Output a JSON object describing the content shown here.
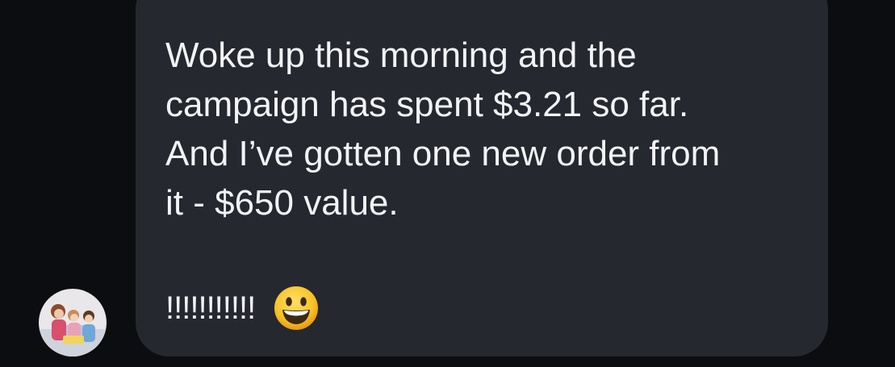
{
  "message": {
    "lines": [
      "Woke up this morning and the",
      "campaign has spent $3.21 so far.",
      "And I’ve gotten one new order from",
      "it - $650 value."
    ],
    "reaction_text": "!!!!!!!!!!!",
    "reaction_emoji": "grinning-face-icon"
  },
  "sender": {
    "avatar": "avatar-photo"
  },
  "colors": {
    "background": "#0b0d10",
    "bubble": "#25282e",
    "text": "#f2f3f5",
    "emoji_face": "#f7c126"
  }
}
